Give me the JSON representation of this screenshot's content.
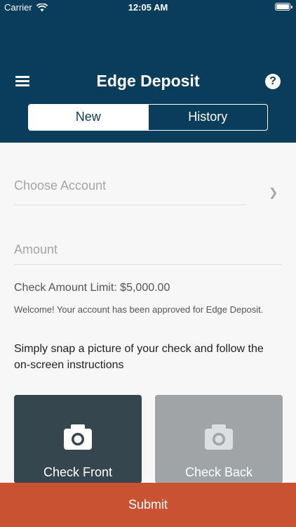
{
  "status_bar": {
    "carrier": "Carrier",
    "time": "12:05 AM"
  },
  "header": {
    "title": "Edge Deposit",
    "help_glyph": "?",
    "menu_icon": "hamburger-menu-icon",
    "help_icon": "help-icon",
    "background_color": "#0a3d5c"
  },
  "tabs": [
    {
      "label": "New",
      "active": true
    },
    {
      "label": "History",
      "active": false
    }
  ],
  "form": {
    "account_placeholder": "Choose Account",
    "amount_placeholder": "Amount"
  },
  "info": {
    "limit": "Check Amount Limit: $5,000.00",
    "welcome": "Welcome! Your account has been approved for Edge Deposit.",
    "instructions": "Simply snap a picture of your check and follow the on-screen instructions"
  },
  "cards": {
    "front": {
      "label": "Check Front",
      "icon": "camera-icon",
      "color": "#36464f"
    },
    "back": {
      "label": "Check Back",
      "icon": "camera-icon",
      "color": "#a0a4a7"
    }
  },
  "submit": {
    "label": "Submit",
    "color": "#c95232"
  }
}
